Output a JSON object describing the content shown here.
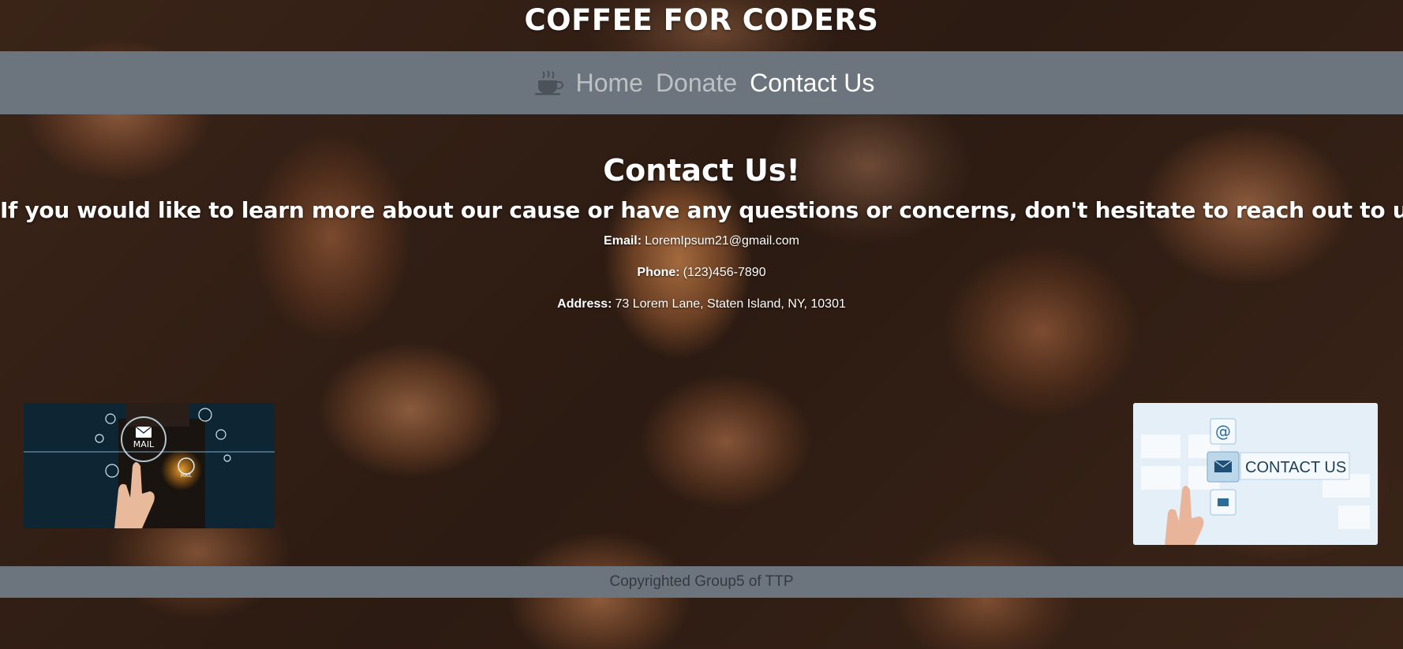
{
  "site": {
    "title": "COFFEE FOR CODERS"
  },
  "nav": {
    "brand_icon": "coffee-cup-icon",
    "links": [
      {
        "label": "Home",
        "active": false
      },
      {
        "label": "Donate",
        "active": false
      },
      {
        "label": "Contact Us",
        "active": true
      }
    ]
  },
  "contact": {
    "heading": "Contact Us!",
    "subheading": "If you would like to learn more about our cause or have any questions or concerns, don't hesitate to reach out to us!",
    "email_label": "Email:",
    "email_value": "LoremIpsum21@gmail.com",
    "phone_label": "Phone:",
    "phone_value": "(123)456-7890",
    "address_label": "Address:",
    "address_value": "73 Lorem Lane, Staten Island, NY, 10301"
  },
  "images": {
    "left": {
      "mail_label": "MAIL",
      "mail_label_small": "MAIL"
    },
    "right": {
      "button_text": "CONTACT US",
      "at_symbol": "@"
    }
  },
  "footer": {
    "text": "Copyrighted Group5 of TTP"
  },
  "colors": {
    "navbar": "#6c757d",
    "footer_text": "#343a40",
    "link_muted": "rgba(255,255,255,0.55)"
  }
}
